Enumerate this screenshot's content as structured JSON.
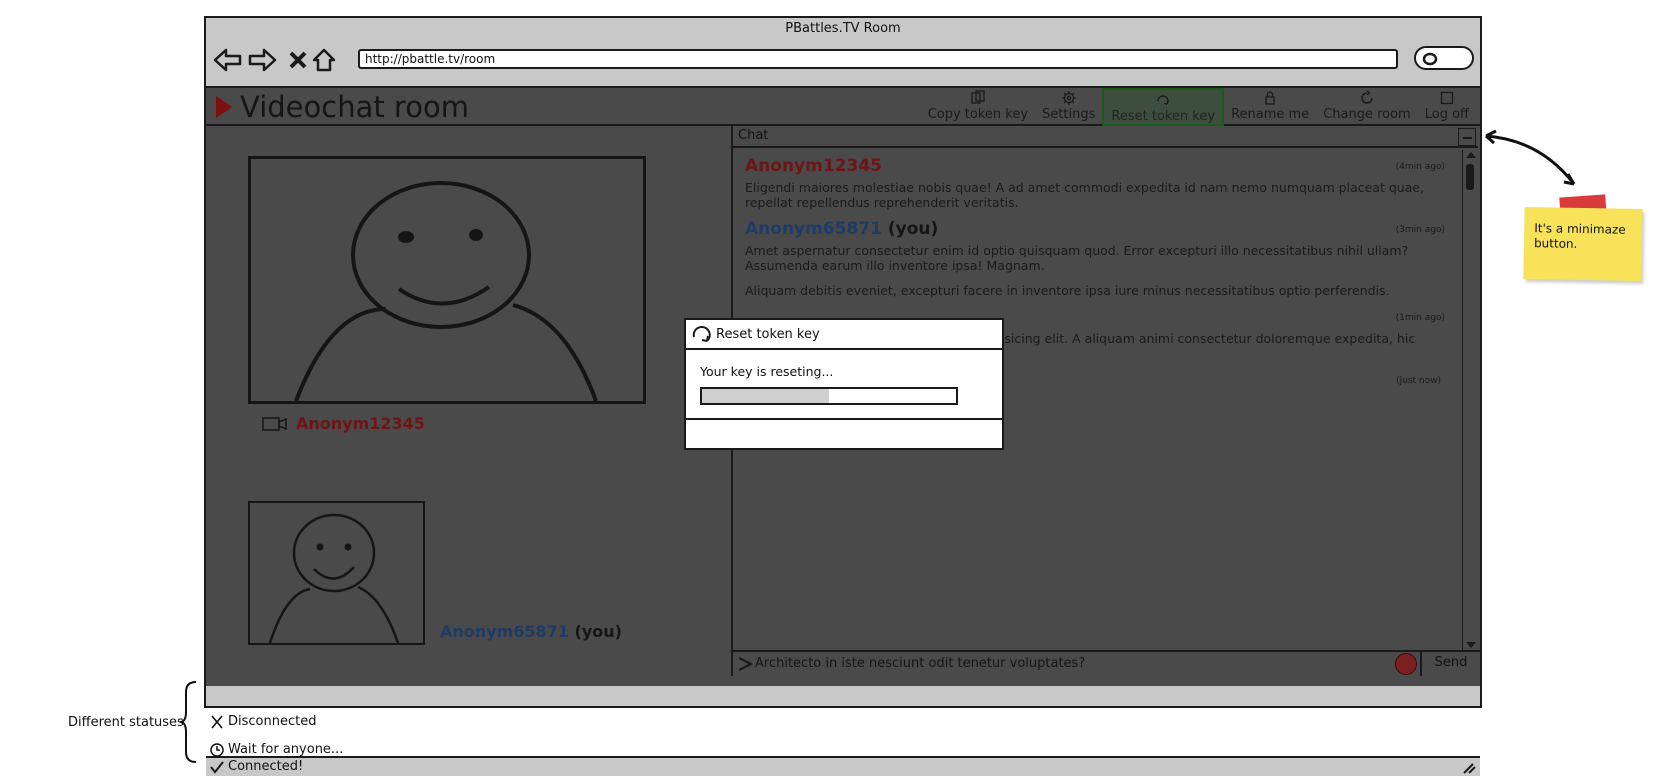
{
  "browser": {
    "title": "PBattles.TV Room",
    "url": "http://pbattle.tv/room"
  },
  "app": {
    "title": "Videochat room",
    "toolbar": [
      {
        "label": "Copy token key",
        "icon": "copy-icon"
      },
      {
        "label": "Settings",
        "icon": "gear-icon"
      },
      {
        "label": "Reset token key",
        "icon": "reset-icon",
        "active": true
      },
      {
        "label": "Rename me",
        "icon": "lock-icon"
      },
      {
        "label": "Change room",
        "icon": "refresh-icon"
      },
      {
        "label": "Log off",
        "icon": "square-icon"
      }
    ]
  },
  "videos": {
    "remote_user": "Anonym12345",
    "self_user": "Anonym65871",
    "self_suffix": "(you)"
  },
  "chat": {
    "title": "Chat",
    "messages": [
      {
        "user": "Anonym12345",
        "suffix": "",
        "time": "(4min ago)",
        "paragraphs": [
          "Eligendi maiores molestiae nobis quae! A ad amet commodi expedita id nam nemo numquam placeat quae, repellat repellendus reprehenderit veritatis."
        ]
      },
      {
        "user": "Anonym65871",
        "suffix": "(you)",
        "time": "(3min ago)",
        "paragraphs": [
          "Amet aspernatur consectetur enim id optio quisquam quod. Error excepturi illo necessitatibus nihil ullam? Assumenda earum illo inventore ipsa! Magnam.",
          "Aliquam debitis eveniet, excepturi facere in inventore ipsa iure minus necessitatibus optio perferendis."
        ]
      },
      {
        "user": "",
        "suffix": "",
        "time": "(1min ago)",
        "paragraphs": [
          "pisicing elit. A aliquam animi consectetur doloremque expedita, hic",
          "?"
        ]
      },
      {
        "user": "",
        "suffix": "",
        "time": "(just now)",
        "paragraphs": []
      }
    ],
    "input_text": "Architecto in iste nesciunt odit tenetur voluptates?",
    "send_label": "Send"
  },
  "status": {
    "current": "Connected!"
  },
  "modal": {
    "title": "Reset token key",
    "message": "Your key is reseting...",
    "progress": 0.5
  },
  "annotations": {
    "statuses_label": "Different statuses",
    "statuses": [
      "Disconnected",
      "Wait for anyone..."
    ],
    "sticky_note": "It's a minimaze button."
  },
  "colors": {
    "remote_user": "#6e1414",
    "self_user": "#1d3b66",
    "active_tool": "#1c5a1c",
    "sticky": "#f7e25a"
  }
}
